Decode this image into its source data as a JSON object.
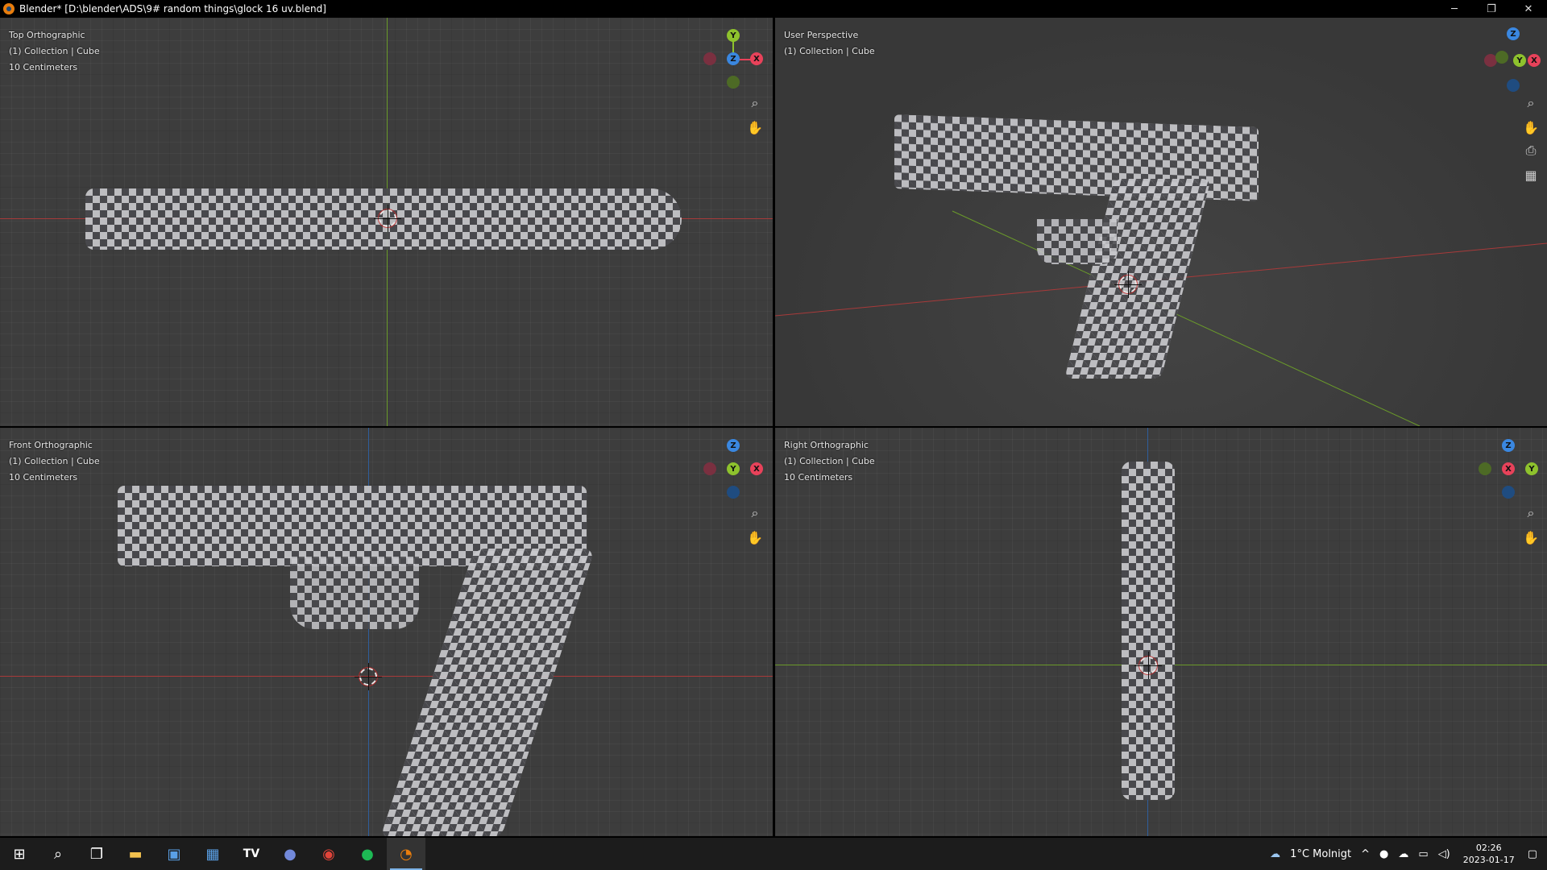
{
  "titlebar": {
    "title": "Blender* [D:\\blender\\ADS\\9# random things\\glock 16 uv.blend]",
    "minimize": "─",
    "restore": "❐",
    "close": "✕"
  },
  "viewports": {
    "top": {
      "view": "Top Orthographic",
      "collection": "(1) Collection | Cube",
      "scale": "10 Centimeters"
    },
    "user": {
      "view": "User Perspective",
      "collection": "(1) Collection | Cube"
    },
    "front": {
      "view": "Front Orthographic",
      "collection": "(1) Collection | Cube",
      "scale": "10 Centimeters"
    },
    "right": {
      "view": "Right Orthographic",
      "collection": "(1) Collection | Cube",
      "scale": "10 Centimeters"
    }
  },
  "gizmo_labels": {
    "x": "X",
    "y": "Y",
    "z": "Z"
  },
  "colors": {
    "axis_x": "#e8425a",
    "axis_y": "#8ec22d",
    "axis_z": "#3a87e0",
    "accent": "#e87d0d"
  },
  "nav_icons": [
    "zoom-icon",
    "pan-hand-icon",
    "camera-icon",
    "grid-icon"
  ],
  "taskbar": {
    "apps": [
      "start-icon",
      "search-icon",
      "task-view-icon",
      "file-explorer-icon",
      "store-icon",
      "calculator-icon",
      "tradingview-icon",
      "discord-icon",
      "chrome-icon",
      "spotify-icon",
      "blender-icon"
    ],
    "weather": "1°C  Molnigt",
    "time": "02:26",
    "date": "2023-01-17"
  }
}
